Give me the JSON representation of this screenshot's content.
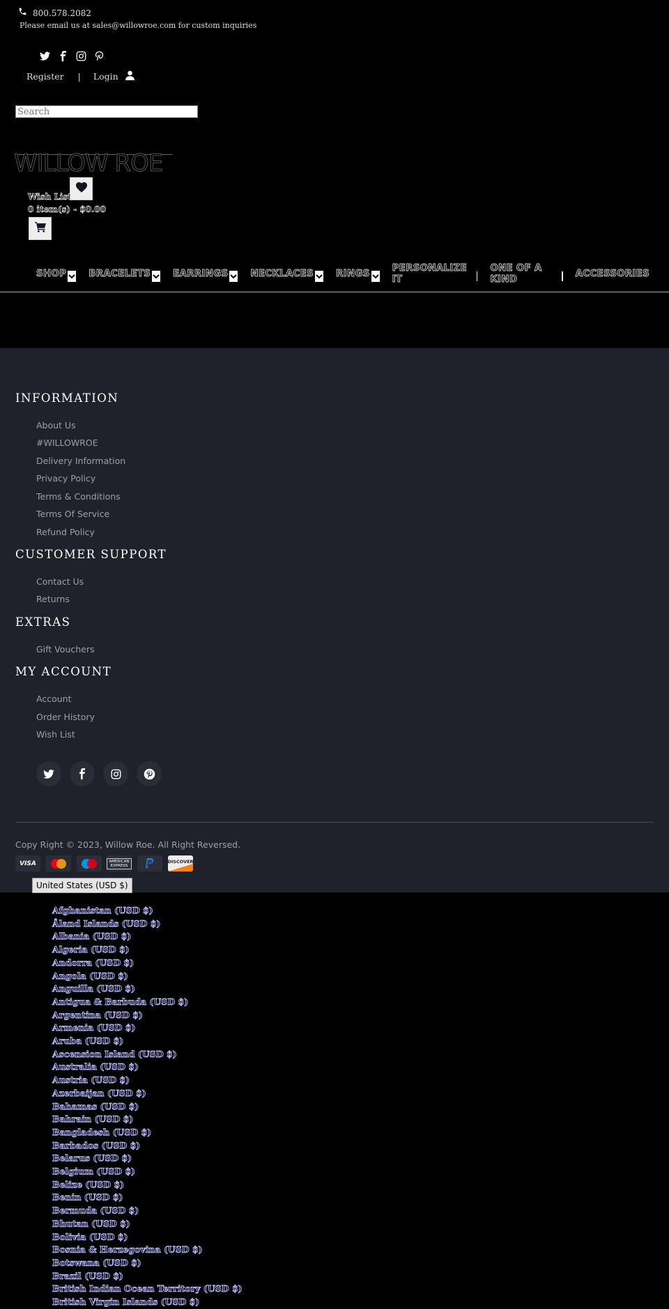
{
  "topbar": {
    "phone": "800.578.2082",
    "email_note": "Please email us at sales@willowroe.com for custom inquiries",
    "social_icons": [
      "twitter-icon",
      "facebook-icon",
      "instagram-icon",
      "pinterest-icon"
    ],
    "register": "Register",
    "separator": "|",
    "login": "Login"
  },
  "search": {
    "placeholder": "Search"
  },
  "brand": {
    "logo_text": "WILLOW ROE"
  },
  "cart": {
    "wish_list": "Wish List",
    "summary": "0 item(s) - $0.00"
  },
  "nav": {
    "items": [
      {
        "label": "SHOP",
        "dropdown": true
      },
      {
        "label": "BRACELETS",
        "dropdown": true
      },
      {
        "label": "EARRINGS",
        "dropdown": true
      },
      {
        "label": "NECKLACES",
        "dropdown": true
      },
      {
        "label": "RINGS",
        "dropdown": true
      },
      {
        "label": "PERSONALIZE IT",
        "dropdown": false
      },
      {
        "label": "ONE OF A KIND",
        "dropdown": false
      },
      {
        "label": "ACCESSORIES",
        "dropdown": false
      }
    ]
  },
  "footer": {
    "information": {
      "title": "INFORMATION",
      "links": [
        "About Us",
        "#WILLOWROE",
        "Delivery Information",
        "Privacy Policy",
        "Terms & Conditions",
        "Terms Of Service",
        "Refund Policy"
      ]
    },
    "support": {
      "title": "CUSTOMER SUPPORT",
      "links": [
        "Contact Us",
        "Returns"
      ]
    },
    "extras": {
      "title": "EXTRAS",
      "links": [
        "Gift Vouchers"
      ]
    },
    "account": {
      "title": "MY ACCOUNT",
      "links": [
        "Account",
        "Order History",
        "Wish List"
      ]
    },
    "social_icons": [
      "twitter-icon",
      "facebook-icon",
      "instagram-icon",
      "pinterest-icon"
    ],
    "copyright": "Copy Right © 2023, Willow Roe. All Right Reversed.",
    "payments": [
      "VISA",
      "mastercard",
      "maestro",
      "AMERICAN EXPRESS",
      "paypal",
      "DISCOVER"
    ]
  },
  "currency": {
    "selected": "United States (USD $)",
    "options": [
      "Afghanistan (USD $)",
      "Åland Islands (USD $)",
      "Albania (USD $)",
      "Algeria (USD $)",
      "Andorra (USD $)",
      "Angola (USD $)",
      "Anguilla (USD $)",
      "Antigua & Barbuda (USD $)",
      "Argentina (USD $)",
      "Armenia (USD $)",
      "Aruba (USD $)",
      "Ascension Island (USD $)",
      "Australia (USD $)",
      "Austria (USD $)",
      "Azerbaijan (USD $)",
      "Bahamas (USD $)",
      "Bahrain (USD $)",
      "Bangladesh (USD $)",
      "Barbados (USD $)",
      "Belarus (USD $)",
      "Belgium (USD $)",
      "Belize (USD $)",
      "Benin (USD $)",
      "Bermuda (USD $)",
      "Bhutan (USD $)",
      "Bolivia (USD $)",
      "Bosnia & Herzegovina (USD $)",
      "Botswana (USD $)",
      "Brazil (USD $)",
      "British Indian Ocean Territory (USD $)",
      "British Virgin Islands (USD $)"
    ]
  },
  "colors": {
    "footer_bg": "#1f222b",
    "link": "#9aa0a6",
    "country_outline": "#b8b8ff"
  }
}
